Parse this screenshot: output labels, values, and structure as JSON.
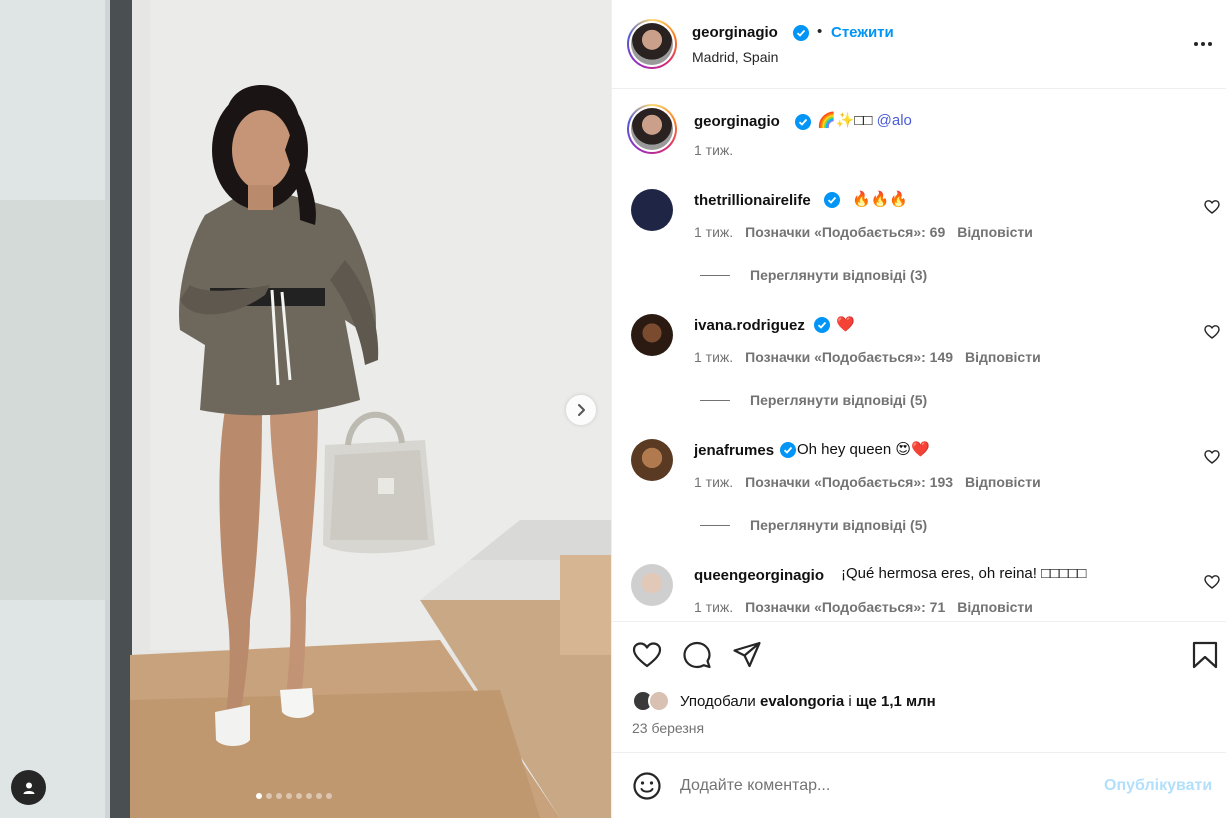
{
  "post": {
    "author": "georginagio",
    "follow_label": "Стежити",
    "separator": "•",
    "location": "Madrid, Spain",
    "caption": {
      "username": "georginagio",
      "emojis": "🌈✨",
      "placeholder_glyphs": "□□",
      "mention": "@alo",
      "time": "1 тиж."
    },
    "carousel": {
      "total": 8,
      "current": 1
    }
  },
  "comments": [
    {
      "username": "thetrillionairelife",
      "text": "🔥🔥🔥",
      "time": "1 тиж.",
      "likes": "Позначки «Подобається»: 69",
      "reply": "Відповісти",
      "view_replies": "Переглянути відповіді (3)"
    },
    {
      "username": "ivana.rodriguez",
      "text": "❤️",
      "time": "1 тиж.",
      "likes": "Позначки «Подобається»: 149",
      "reply": "Відповісти",
      "view_replies": "Переглянути відповіді (5)"
    },
    {
      "username": "jenafrumes",
      "text": "Oh hey queen 😍❤️",
      "time": "1 тиж.",
      "likes": "Позначки «Подобається»: 193",
      "reply": "Відповісти",
      "view_replies": "Переглянути відповіді (5)"
    },
    {
      "username": "queengeorginagio",
      "text": "¡Qué hermosa eres, oh reina! □□□□□",
      "time": "1 тиж.",
      "likes": "Позначки «Подобається»: 71",
      "reply": "Відповісти"
    }
  ],
  "likes": {
    "prefix": "Уподобали",
    "user": "evalongoria",
    "middle": "і",
    "rest": "ще 1,1 млн"
  },
  "date": "23 березня",
  "composer": {
    "placeholder": "Додайте коментар...",
    "post_label": "Опублікувати"
  },
  "icons": {
    "verified": "verified-badge-icon",
    "like": "heart-icon",
    "comment": "comment-icon",
    "share": "share-icon",
    "save": "bookmark-icon",
    "more": "more-horizontal-icon",
    "next": "chevron-right-icon",
    "emoji": "emoji-icon",
    "tagged": "user-tag-icon"
  },
  "colors": {
    "accent": "#0095f6",
    "verified": "#0095f6",
    "mention": "#4a5dd6",
    "muted": "#737373",
    "post_disabled": "#b2dffc"
  }
}
